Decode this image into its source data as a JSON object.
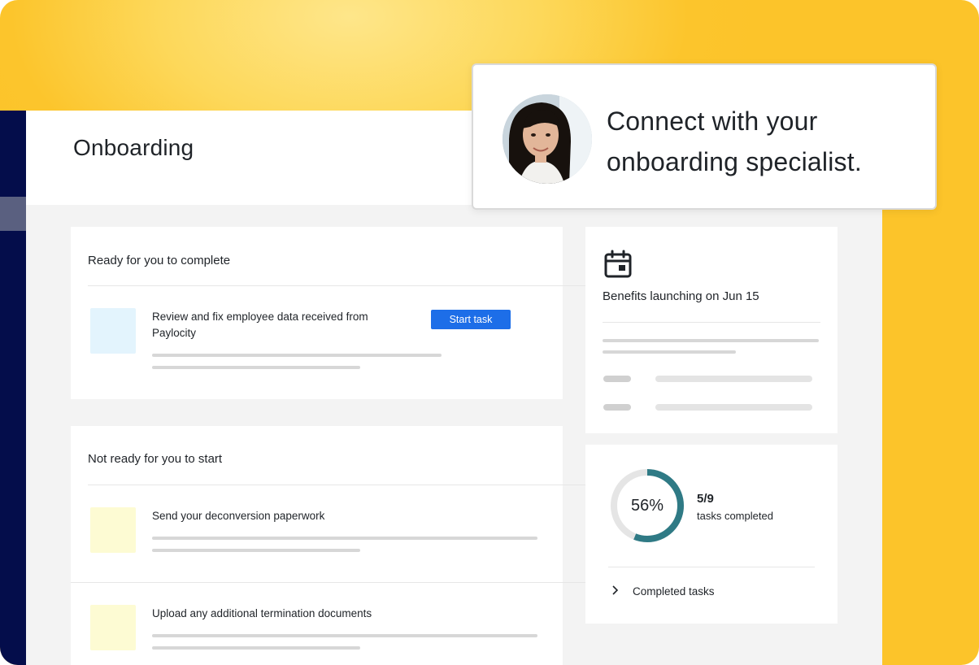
{
  "page": {
    "title": "Onboarding"
  },
  "popup": {
    "line1": "Connect with your",
    "line2": "onboarding specialist."
  },
  "ready_section": {
    "title": "Ready for you to complete",
    "tasks": [
      {
        "label_line1": "Review and fix employee data received from",
        "label_line2": "Paylocity",
        "button_label": "Start task",
        "thumb_color": "#e3f4fd"
      }
    ]
  },
  "not_ready_section": {
    "title": "Not ready for you to start",
    "tasks": [
      {
        "label": "Send your deconversion paperwork",
        "thumb_color": "#fdfbd3"
      },
      {
        "label": "Upload any additional termination documents",
        "thumb_color": "#fdfbd3"
      }
    ]
  },
  "benefits_card": {
    "icon": "calendar-icon",
    "title": "Benefits launching on Jun 15"
  },
  "progress_card": {
    "percent_label": "56%",
    "percent_value": 56,
    "count": "5/9",
    "count_label": "tasks completed",
    "link_label": "Completed tasks",
    "ring_color": "#2f7a85",
    "track_color": "#e5e5e5"
  },
  "colors": {
    "accent_blue": "#1d6ee8",
    "nav_dark": "#040d4b",
    "brand_yellow": "#fcc42a"
  }
}
